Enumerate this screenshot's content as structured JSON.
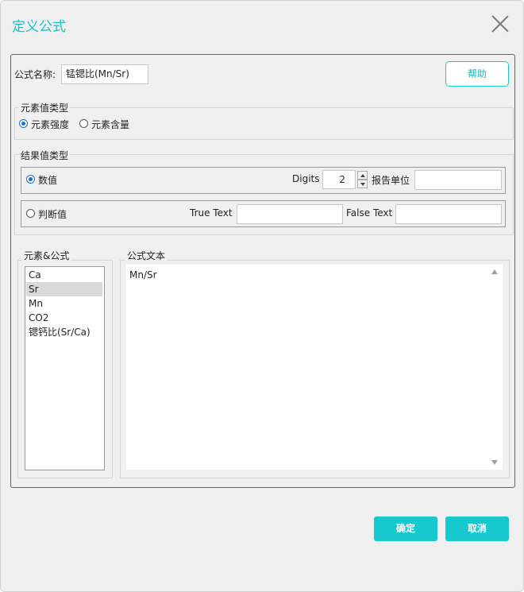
{
  "dialog": {
    "title": "定义公式",
    "close_icon": "close-icon"
  },
  "formula_name": {
    "label": "公式名称:",
    "value": "锰锶比(Mn/Sr)"
  },
  "help_button": "帮助",
  "element_value_type": {
    "legend": "元素值类型",
    "options": [
      "元素强度",
      "元素含量"
    ],
    "selected": "元素强度"
  },
  "result_value_type": {
    "legend": "结果值类型",
    "numeric": {
      "label": "数值",
      "selected": true,
      "digits_label": "Digits",
      "digits_value": "2",
      "report_unit_label": "报告单位",
      "report_unit_value": ""
    },
    "boolean": {
      "label": "判断值",
      "selected": false,
      "true_text_label": "True Text",
      "true_text_value": "",
      "false_text_label": "False Text",
      "false_text_value": ""
    }
  },
  "elements_formulas": {
    "legend": "元素&公式",
    "items": [
      "Ca",
      "Sr",
      "Mn",
      "CO2",
      "锶钙比(Sr/Ca)"
    ],
    "selected": "Sr"
  },
  "formula_text": {
    "legend": "公式文本",
    "value": "Mn/Sr"
  },
  "footer": {
    "ok": "确定",
    "cancel": "取消"
  },
  "colors": {
    "accent": "#17c9cf",
    "title": "#17c3c8",
    "radio_selected": "#1a6fd0",
    "background": "#f0f0f0"
  }
}
